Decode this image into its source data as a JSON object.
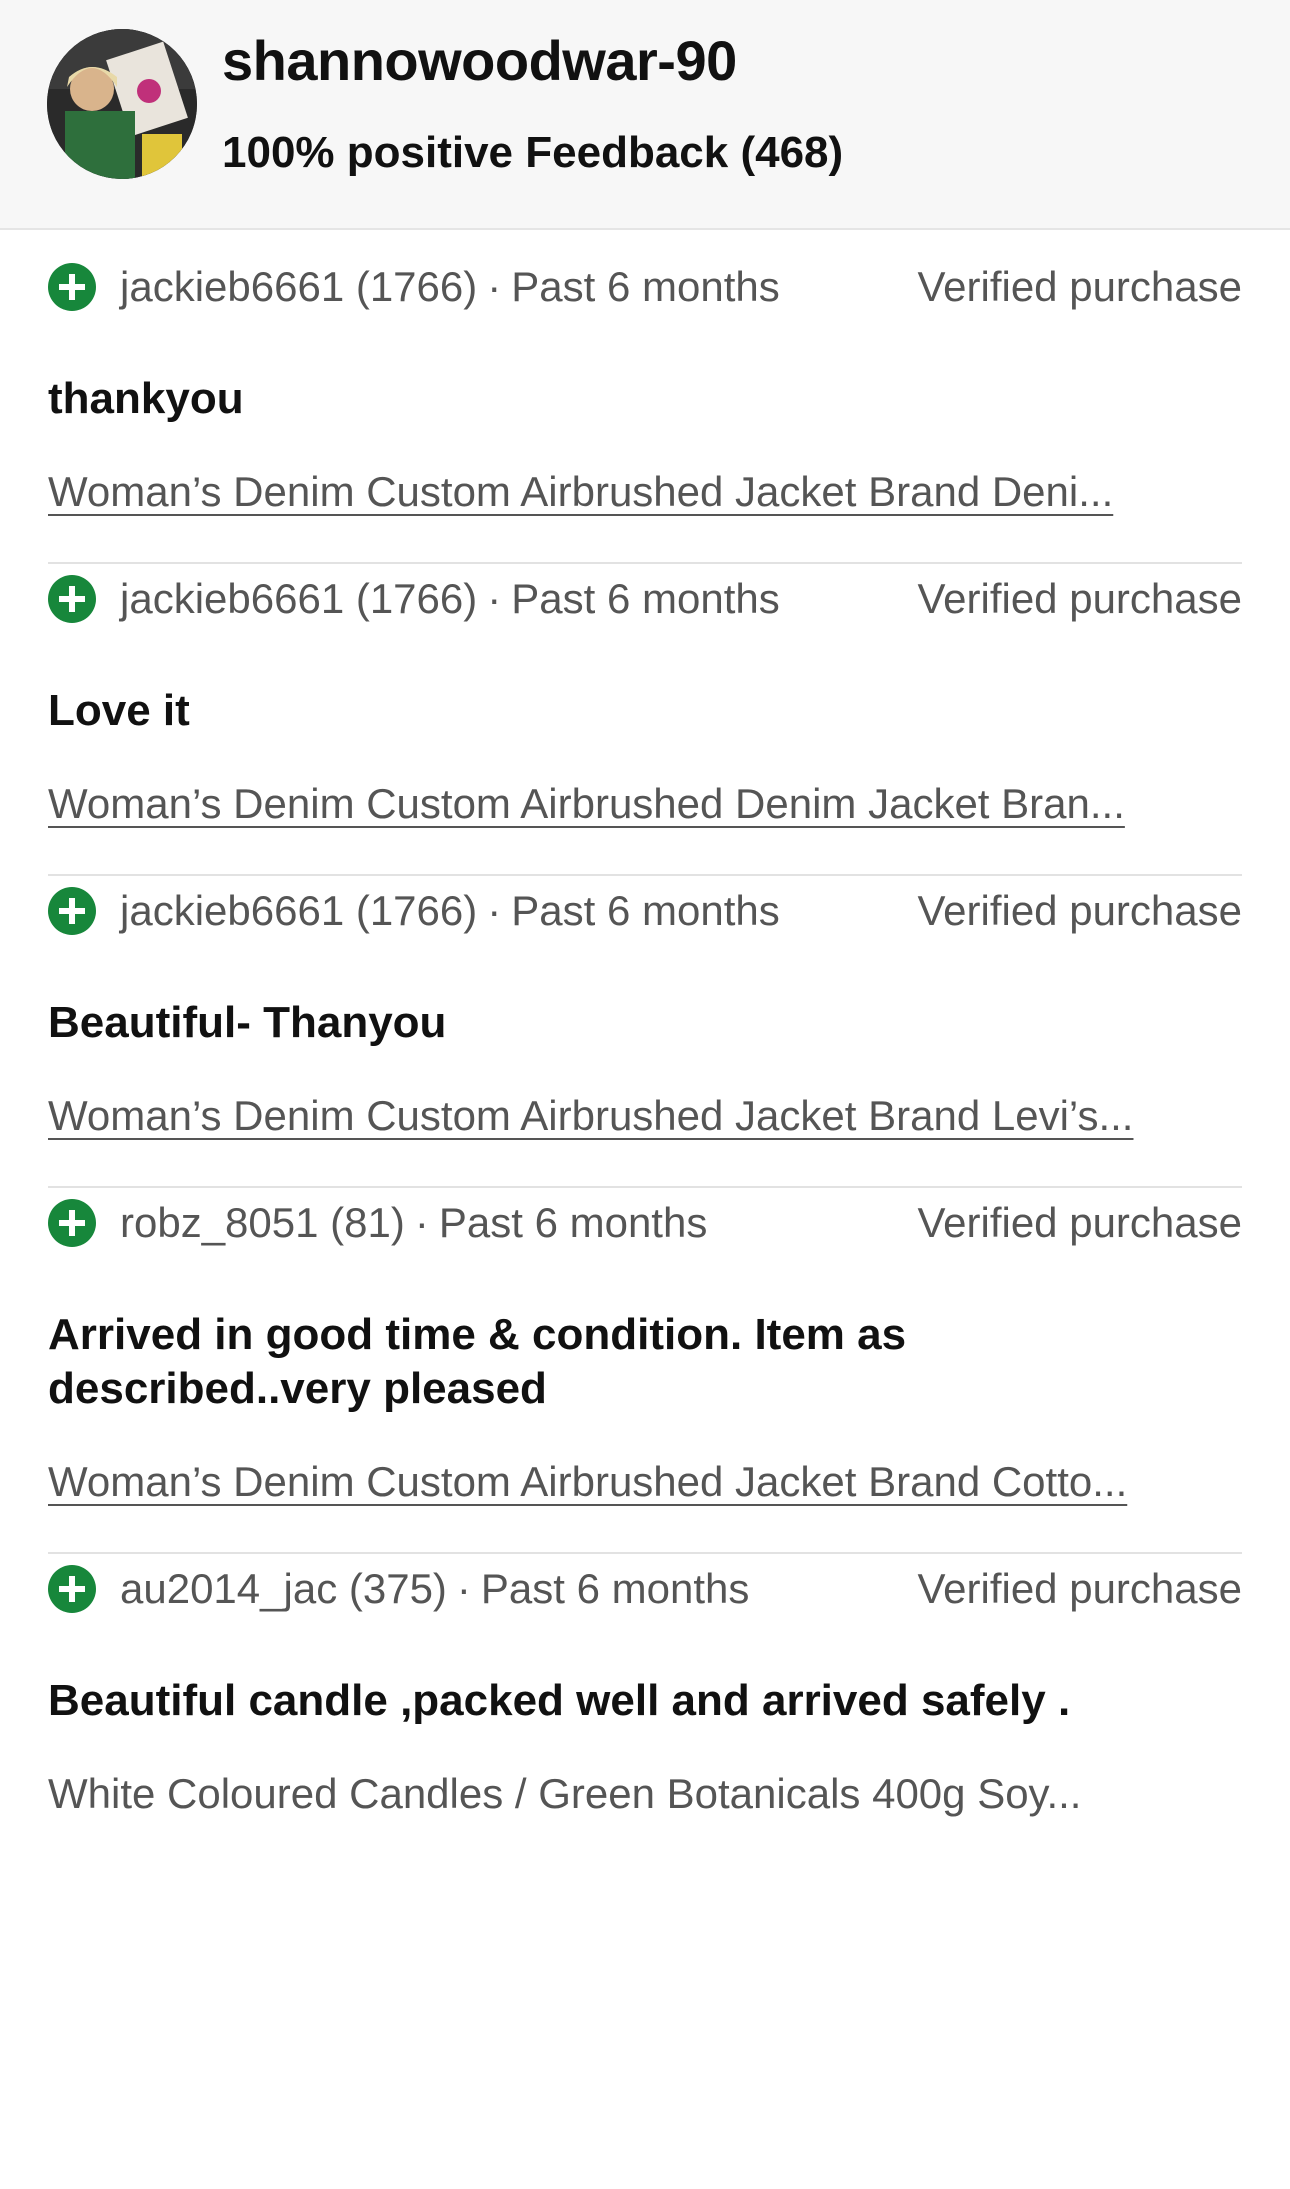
{
  "seller": {
    "username": "shannowoodwar-90",
    "feedback_summary": "100% positive Feedback (468)"
  },
  "reviews": [
    {
      "reviewer": "jackieb6661 (1766)",
      "period": "Past 6 months",
      "badge": "Verified purchase",
      "comment": "thankyou",
      "item": "Woman’s Denim Custom Airbrushed Jacket Brand Deni..."
    },
    {
      "reviewer": "jackieb6661 (1766)",
      "period": "Past 6 months",
      "badge": "Verified purchase",
      "comment": "Love it",
      "item": "Woman’s Denim Custom Airbrushed Denim Jacket Bran..."
    },
    {
      "reviewer": "jackieb6661 (1766)",
      "period": "Past 6 months",
      "badge": "Verified purchase",
      "comment": "Beautiful- Thanyou",
      "item": "Woman’s Denim Custom Airbrushed Jacket Brand Levi’s..."
    },
    {
      "reviewer": "robz_8051 (81)",
      "period": "Past 6 months",
      "badge": "Verified purchase",
      "comment": "Arrived in good time & condition. Item as described..very pleased",
      "item": "Woman’s Denim Custom Airbrushed Jacket Brand Cotto..."
    },
    {
      "reviewer": "au2014_jac (375)",
      "period": "Past 6 months",
      "badge": "Verified purchase",
      "comment": "Beautiful candle ,packed well and arrived safely .",
      "item": "White Coloured Candles / Green Botanicals 400g Soy..."
    }
  ],
  "colors": {
    "positive_icon": "#17873b",
    "secondary_text": "#555555",
    "header_bg": "#f7f7f7"
  },
  "icons": {
    "positive": "plus-circle-icon"
  },
  "separator": "·"
}
